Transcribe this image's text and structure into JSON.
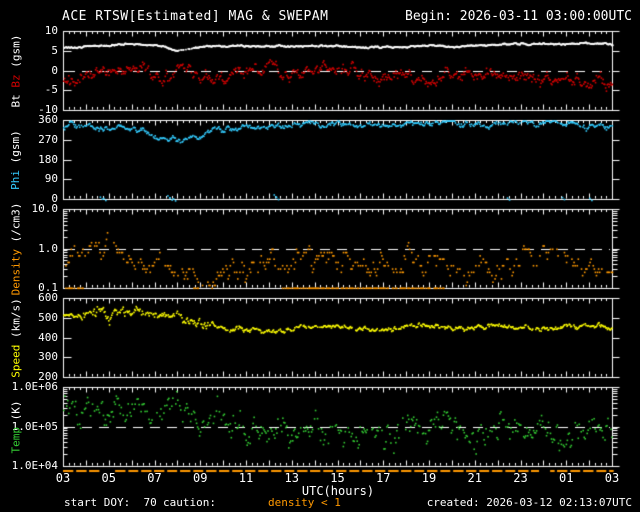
{
  "title": "ACE RTSW[Estimated] MAG & SWEPAM",
  "begin_label": "Begin: 2026-03-11 03:00:00UTC",
  "footer": {
    "start_doy": "start DOY:  70",
    "caution_label": "caution:",
    "caution_value": "density < 1",
    "created": "created: 2026-03-12 02:13:07UTC"
  },
  "xaxis": {
    "title": "UTC(hours)",
    "lim_hours": [
      3,
      27
    ],
    "tick_hours": [
      3,
      5,
      7,
      9,
      11,
      13,
      15,
      17,
      19,
      21,
      23,
      25,
      27
    ],
    "tick_labels": [
      "03",
      "05",
      "07",
      "09",
      "11",
      "13",
      "15",
      "17",
      "19",
      "21",
      "23",
      "01",
      "03"
    ]
  },
  "colors": {
    "background": "#000000",
    "frame": "#ffffff",
    "refline": "#ffffff",
    "caution": "#ff9900"
  },
  "chart_data": [
    {
      "type": "scatter",
      "name": "mag",
      "scale": "linear",
      "ylim": [
        -10,
        10
      ],
      "yticks": [
        {
          "v": 10,
          "label": "10"
        },
        {
          "v": 5,
          "label": "5"
        },
        {
          "v": 0,
          "label": "0"
        },
        {
          "v": -5,
          "label": "-5"
        },
        {
          "v": -10,
          "label": "-10"
        }
      ],
      "refline": 0,
      "label_parts": [
        {
          "text": "Bt ",
          "color": "#ffffff"
        },
        {
          "text": "Bz",
          "color": "#d40000"
        },
        {
          "text": " (gsm)",
          "color": "#ffffff"
        }
      ],
      "x": [
        3,
        4,
        5,
        6,
        7,
        8,
        9,
        10,
        11,
        12,
        13,
        14,
        15,
        16,
        17,
        18,
        19,
        20,
        21,
        22,
        23,
        24,
        25,
        26,
        27
      ],
      "series": [
        {
          "name": "Bt",
          "color": "#ffffff",
          "noise": 0.13,
          "ar": 0.8,
          "step_min": 1.2,
          "skip": 0.05,
          "dot": 1.6,
          "gaps": [
            [
              8.0,
              8.7
            ]
          ],
          "values": [
            6.0,
            6.3,
            6.6,
            6.9,
            6.6,
            5.2,
            6.2,
            6.3,
            6.4,
            6.3,
            6.2,
            6.4,
            6.3,
            6.2,
            6.1,
            6.3,
            6.4,
            6.2,
            6.5,
            6.7,
            6.9,
            6.8,
            7.0,
            7.1,
            6.7
          ]
        },
        {
          "name": "Bz",
          "color": "#d40000",
          "noise": 1.0,
          "ar": 0.75,
          "step_min": 2.2,
          "skip": 0.05,
          "dot": 1.6,
          "values": [
            -2.5,
            -1.0,
            1.5,
            0.5,
            -1.5,
            -0.5,
            -1.0,
            -1.5,
            -0.5,
            0.5,
            -1.5,
            0.0,
            1.0,
            -0.5,
            -1.5,
            -1.0,
            -2.0,
            -0.5,
            -1.0,
            -2.0,
            -1.5,
            -2.5,
            -2.0,
            -3.0,
            -1.5
          ]
        }
      ]
    },
    {
      "type": "scatter",
      "name": "phi",
      "scale": "linear",
      "ylim": [
        0,
        360
      ],
      "yticks": [
        {
          "v": 360,
          "label": "360"
        },
        {
          "v": 270,
          "label": "270"
        },
        {
          "v": 180,
          "label": "180"
        },
        {
          "v": 90,
          "label": "90"
        },
        {
          "v": 0,
          "label": "0"
        }
      ],
      "refline": null,
      "label_parts": [
        {
          "text": "Phi",
          "color": "#33ccff"
        },
        {
          "text": " (gsm)",
          "color": "#ffffff"
        }
      ],
      "x": [
        3,
        4,
        5,
        6,
        7,
        8,
        9,
        10,
        11,
        12,
        13,
        14,
        15,
        16,
        17,
        18,
        19,
        20,
        21,
        22,
        23,
        24,
        25,
        26,
        27
      ],
      "series": [
        {
          "name": "Phi",
          "color": "#33ccff",
          "noise": 9,
          "ar": 0.8,
          "step_min": 2.2,
          "skip": 0.12,
          "dot": 1.6,
          "outliers": [
            [
              4.6,
              12
            ],
            [
              4.75,
              6
            ],
            [
              7.55,
              18
            ],
            [
              7.65,
              8
            ],
            [
              7.8,
              4
            ],
            [
              12.2,
              22
            ],
            [
              12.3,
              10
            ],
            [
              22.4,
              8
            ],
            [
              24.8,
              10
            ],
            [
              26.0,
              6
            ]
          ],
          "values": [
            330,
            335,
            330,
            320,
            295,
            265,
            310,
            325,
            330,
            335,
            340,
            345,
            345,
            340,
            335,
            345,
            350,
            348,
            342,
            346,
            350,
            346,
            340,
            336,
            342
          ]
        }
      ]
    },
    {
      "type": "scatter",
      "name": "density",
      "scale": "log",
      "ylim": [
        0.1,
        10
      ],
      "yticks": [
        {
          "v": 10,
          "label": "10.0"
        },
        {
          "v": 1,
          "label": "1.0"
        },
        {
          "v": 0.1,
          "label": "0.1"
        }
      ],
      "refline": 1.0,
      "label_parts": [
        {
          "text": "Density",
          "color": "#ff9900"
        },
        {
          "text": " (/cm3)",
          "color": "#ffffff"
        }
      ],
      "x": [
        3,
        4,
        5,
        6,
        7,
        8,
        9,
        10,
        11,
        12,
        13,
        14,
        15,
        16,
        17,
        18,
        19,
        20,
        21,
        22,
        23,
        24,
        25,
        26,
        27
      ],
      "series": [
        {
          "name": "Density",
          "color": "#ff9900",
          "noise": 0.17,
          "ar": 0.7,
          "step_min": 2.8,
          "skip": 0.35,
          "dot": 1.6,
          "quantize": true,
          "floor": 0.103,
          "floor_runs": true,
          "values": [
            0.3,
            0.8,
            1.1,
            0.5,
            0.25,
            0.3,
            0.2,
            0.25,
            0.3,
            0.5,
            0.35,
            0.8,
            0.4,
            0.3,
            0.5,
            0.6,
            0.5,
            0.3,
            0.25,
            0.3,
            0.4,
            1.2,
            0.5,
            0.4,
            0.3
          ]
        }
      ]
    },
    {
      "type": "scatter",
      "name": "speed",
      "scale": "linear",
      "ylim": [
        200,
        600
      ],
      "yticks": [
        {
          "v": 600,
          "label": "600"
        },
        {
          "v": 500,
          "label": "500"
        },
        {
          "v": 400,
          "label": "400"
        },
        {
          "v": 300,
          "label": "300"
        },
        {
          "v": 200,
          "label": "200"
        }
      ],
      "refline": null,
      "label_parts": [
        {
          "text": "Speed",
          "color": "#ffff00"
        },
        {
          "text": " (km/s)",
          "color": "#ffffff"
        }
      ],
      "x": [
        3,
        4,
        5,
        6,
        7,
        8,
        9,
        10,
        11,
        12,
        13,
        14,
        15,
        16,
        17,
        18,
        19,
        20,
        21,
        22,
        23,
        24,
        25,
        26,
        27
      ],
      "series": [
        {
          "name": "Speed",
          "color": "#ffff00",
          "noise": 18,
          "noise2": 8,
          "noise_split": 9.5,
          "ar": 0.75,
          "step_min": 2.0,
          "skip": 0.15,
          "dot": 1.6,
          "values": [
            515,
            505,
            520,
            535,
            525,
            510,
            465,
            450,
            445,
            440,
            450,
            460,
            455,
            450,
            445,
            455,
            465,
            450,
            455,
            462,
            455,
            450,
            458,
            452,
            448
          ]
        }
      ]
    },
    {
      "type": "scatter",
      "name": "temp",
      "scale": "log",
      "ylim": [
        10000,
        1000000
      ],
      "yticks": [
        {
          "v": 1000000,
          "label": "1.0E+06"
        },
        {
          "v": 100000,
          "label": "1.0E+05"
        },
        {
          "v": 10000,
          "label": "1.0E+04"
        }
      ],
      "refline": 100000,
      "label_parts": [
        {
          "text": "Temp",
          "color": "#33cc33"
        },
        {
          "text": " (K)",
          "color": "#ffffff"
        }
      ],
      "x": [
        3,
        4,
        5,
        6,
        7,
        8,
        9,
        10,
        11,
        12,
        13,
        14,
        15,
        16,
        17,
        18,
        19,
        20,
        21,
        22,
        23,
        24,
        25,
        26,
        27
      ],
      "series": [
        {
          "name": "Temp",
          "color": "#33cc33",
          "noise": 0.22,
          "ar": 0.6,
          "step_min": 2.6,
          "skip": 0.25,
          "dot": 1.6,
          "values": [
            300000,
            250000,
            200000,
            300000,
            250000,
            300000,
            200000,
            150000,
            80000,
            70000,
            60000,
            80000,
            70000,
            60000,
            80000,
            90000,
            70000,
            80000,
            70000,
            80000,
            90000,
            80000,
            70000,
            70000,
            80000
          ]
        }
      ]
    }
  ]
}
